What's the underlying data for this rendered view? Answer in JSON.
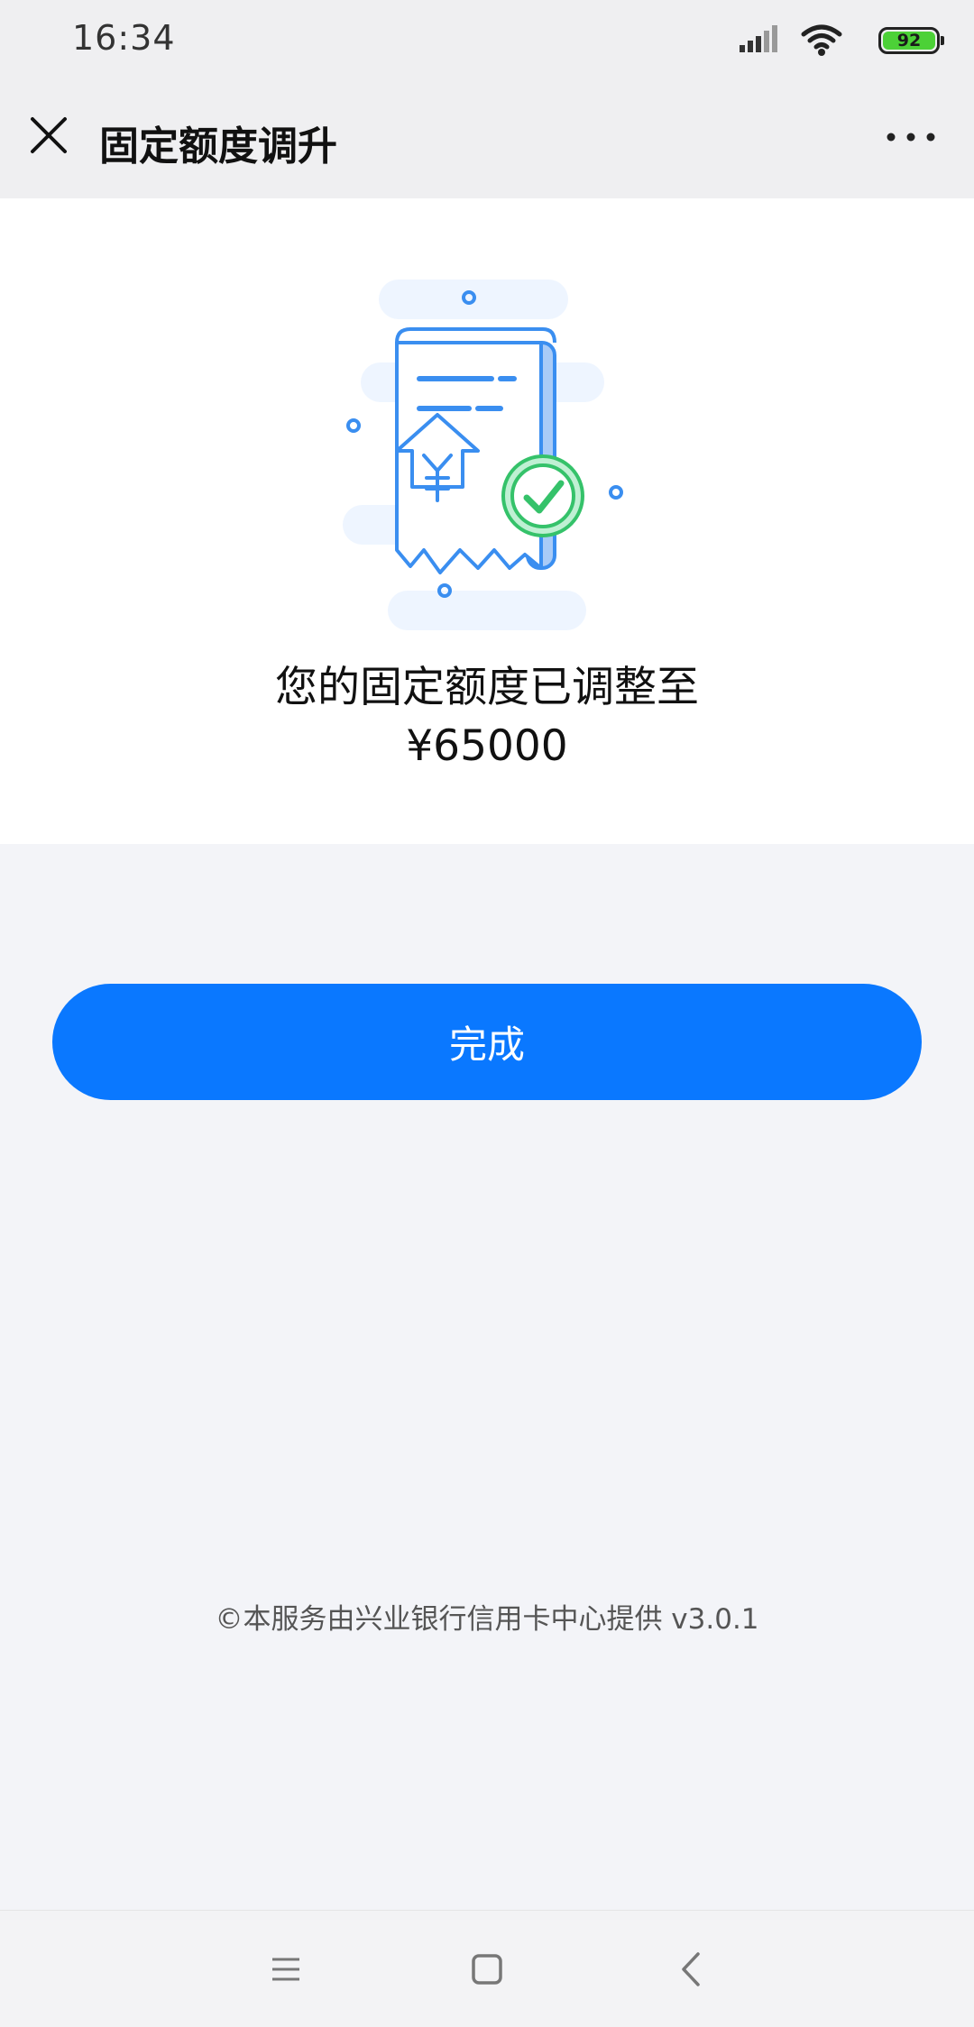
{
  "status_bar": {
    "time": "16:34",
    "battery": "92",
    "icons": [
      "signal-icon",
      "wifi-icon",
      "battery-icon"
    ]
  },
  "nav": {
    "title": "固定额度调升",
    "close_icon": "close-icon",
    "more_icon": "more-icon"
  },
  "result": {
    "illustration": "receipt-check-icon",
    "message": "您的固定额度已调整至",
    "amount": "¥65000"
  },
  "done_button": {
    "label": "完成"
  },
  "footer": {
    "text": "©本服务由兴业银行信用卡中心提供 v3.0.1"
  },
  "system_nav": {
    "icons": [
      "menu-icon",
      "home-icon",
      "back-icon"
    ]
  },
  "colors": {
    "primary": "#0a78ff",
    "success": "#35c26a",
    "illustration_blue": "#3a8ef0",
    "background": "#f3f4f8"
  }
}
